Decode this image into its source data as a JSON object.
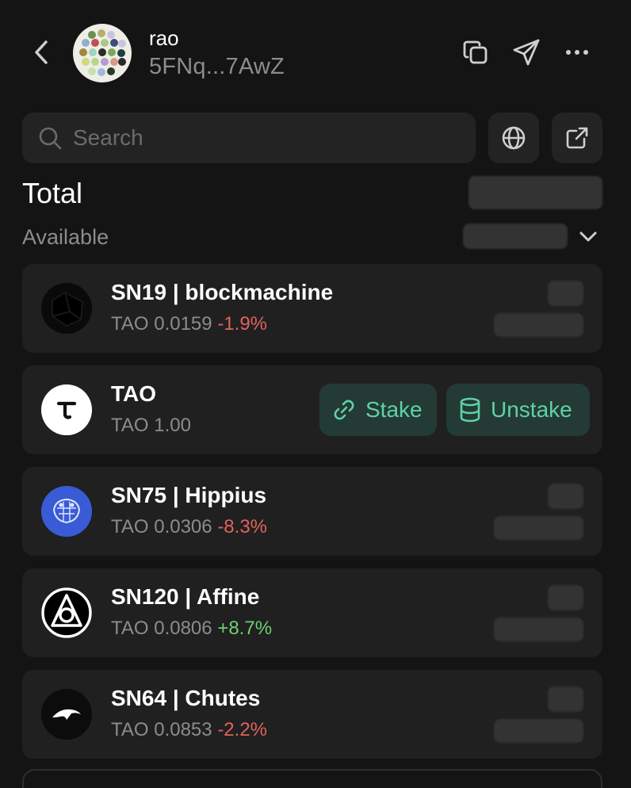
{
  "account": {
    "name": "rao",
    "address": "5FNq...7AwZ"
  },
  "search": {
    "placeholder": "Search"
  },
  "summary": {
    "total_label": "Total",
    "available_label": "Available"
  },
  "balances": [
    {
      "name": "SN19 | blockmachine",
      "amount": "TAO 0.0159",
      "change": "-1.9%",
      "logo_icon": "blockmachine-icon"
    },
    {
      "name": "TAO",
      "amount": "TAO 1.00",
      "logo_icon": "tao-icon",
      "stake_label": "Stake",
      "unstake_label": "Unstake"
    },
    {
      "name": "SN75 | Hippius",
      "amount": "TAO 0.0306",
      "change": "-8.3%",
      "logo_icon": "hippius-icon"
    },
    {
      "name": "SN120 | Affine",
      "amount": "TAO 0.0806",
      "change": "+8.7%",
      "logo_icon": "affine-icon"
    },
    {
      "name": "SN64 | Chutes",
      "amount": "TAO 0.0853",
      "change": "-2.2%",
      "logo_icon": "chutes-icon"
    }
  ],
  "icons": [
    "back-icon",
    "copy-icon",
    "send-icon",
    "more-icon",
    "search-icon",
    "globe-icon",
    "external-link-icon",
    "chevron-down-icon",
    "link-icon",
    "database-icon"
  ],
  "colors": {
    "background": "#141414",
    "card": "#202020",
    "accent": "#5fd1a8",
    "negative": "#e0635c",
    "positive": "#6fcf72"
  }
}
